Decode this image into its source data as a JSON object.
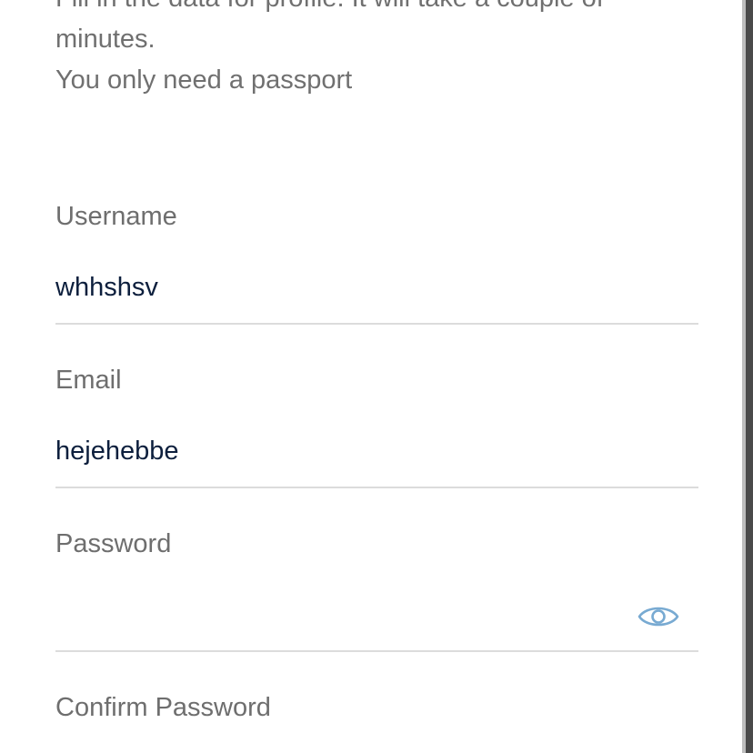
{
  "intro": {
    "line1": "Fill in the data for profile. It will take a couple of",
    "line2": "minutes.",
    "line3": "You only need a passport"
  },
  "form": {
    "username": {
      "label": "Username",
      "value": "whhshsv"
    },
    "email": {
      "label": "Email",
      "value": "hejehebbe"
    },
    "password": {
      "label": "Password",
      "value": "",
      "toggle_icon": "eye-icon"
    },
    "confirm_password": {
      "label": "Confirm Password"
    }
  },
  "colors": {
    "label_text": "#6e6e6e",
    "value_text": "#0d1f3d",
    "underline": "#dcdcdc",
    "eye_icon": "#78aad2"
  }
}
